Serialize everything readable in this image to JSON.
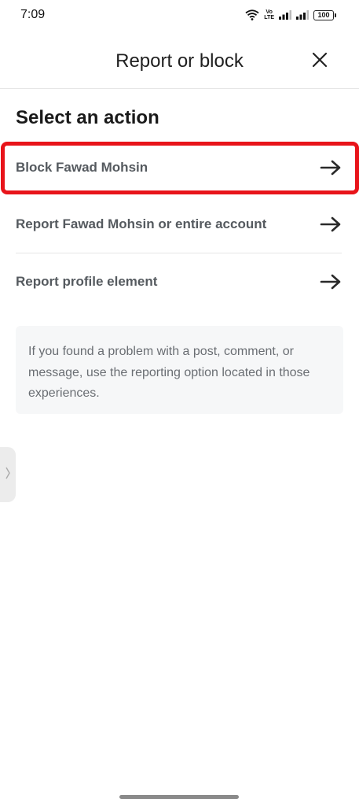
{
  "status_bar": {
    "time": "7:09",
    "volte_top": "Vo",
    "volte_bottom": "LTE",
    "battery": "100"
  },
  "header": {
    "title": "Report or block",
    "close_icon": "close-icon"
  },
  "section_heading": "Select an action",
  "actions": [
    {
      "label": "Block Fawad Mohsin",
      "icon": "arrow-right-icon",
      "highlighted": true
    },
    {
      "label": "Report Fawad Mohsin or entire account",
      "icon": "arrow-right-icon"
    },
    {
      "label": "Report profile element",
      "icon": "arrow-right-icon"
    }
  ],
  "info_text": "If you found a problem with a post, comment, or message, use the reporting option located in those experiences.",
  "colors": {
    "highlight": "#e8141a",
    "action_text": "#555a5f",
    "info_bg": "#f6f7f8"
  }
}
